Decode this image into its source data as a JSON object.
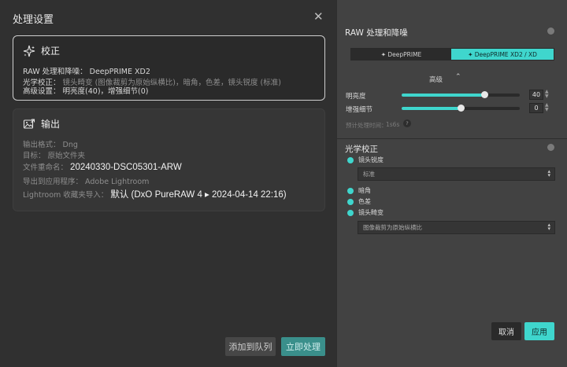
{
  "dialog": {
    "title": "处理设置",
    "close_glyph": "✕",
    "correction_card": {
      "title": "校正",
      "icon": "sparkle-icon",
      "raw_label": "RAW 处理和降噪：",
      "raw_value": "DeepPRIME XD2",
      "optical_label": "光学校正：",
      "optical_value": "镜头畸变 (图像裁剪为原始纵横比)，暗角，色差，镜头锐度 (标准)",
      "advanced_label": "高级设置：",
      "advanced_value": "明亮度(40)，增强细节(0)"
    },
    "output_card": {
      "title": "输出",
      "icon": "image-export-icon",
      "format_label": "输出格式：",
      "format_value": "Dng",
      "target_label": "目标：",
      "target_value": "原始文件夹",
      "rename_label": "文件重命名：",
      "rename_value": "20240330-DSC05301-ARW",
      "export_app_label": "导出到应用程序：",
      "export_app_value": "Adobe Lightroom",
      "lightroom_label": "Lightroom 收藏夹导入：",
      "lightroom_value": "默认 (DxO PureRAW 4 ▸ 2024-04-14 22:16)"
    },
    "buttons": {
      "queue": "添加到队列",
      "process_now": "立即处理"
    }
  },
  "panel": {
    "raw_title": "RAW 处理和降噪",
    "modes": {
      "option_a": "✦ DeepPRIME",
      "option_b": "✦ DeepPRIME XD2 / XD",
      "selected": "option_b"
    },
    "advanced_label": "高级",
    "advanced_chevron": "⌃",
    "brightness": {
      "label": "明亮度",
      "value": 40,
      "min": -100,
      "max": 100
    },
    "detail": {
      "label": "增强细节",
      "value": 0,
      "min": -100,
      "max": 100
    },
    "estimate_label": "预计处理时间：",
    "estimate_value": "1s6s",
    "estimate_help": "?",
    "optical_title": "光学校正",
    "lens_sharpness": {
      "label": "镜头锐度",
      "checked": true,
      "dropdown": "标准"
    },
    "vignetting": {
      "label": "暗角",
      "checked": true
    },
    "chromatic": {
      "label": "色差",
      "checked": true
    },
    "distortion": {
      "label": "镜头畸变",
      "checked": true,
      "dropdown": "图像裁剪为原始纵横比"
    },
    "buttons": {
      "cancel": "取消",
      "apply": "应用"
    }
  },
  "colors": {
    "accent": "#3fd6cd",
    "dialog_bg": "#303030",
    "panel_bg": "#424242"
  }
}
